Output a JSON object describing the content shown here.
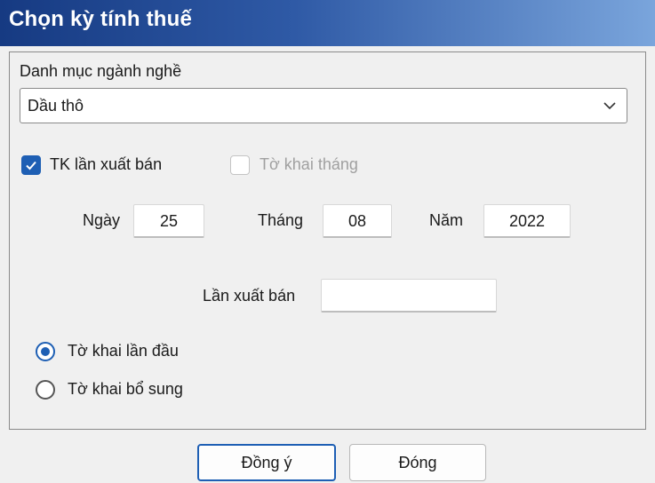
{
  "window": {
    "title": "Chọn kỳ tính thuế"
  },
  "category": {
    "label": "Danh mục ngành nghề",
    "selected": "Dầu thô"
  },
  "options": {
    "tk_lan_xuat_ban": {
      "label": "TK lần xuất bán",
      "checked": true
    },
    "to_khai_thang": {
      "label": "Tờ khai tháng",
      "checked": false,
      "disabled": true
    }
  },
  "date": {
    "day_label": "Ngày",
    "day_value": "25",
    "month_label": "Tháng",
    "month_value": "08",
    "year_label": "Năm",
    "year_value": "2022"
  },
  "sale_count": {
    "label": "Lần xuất bán",
    "value": ""
  },
  "declaration_type": {
    "first_label": "Tờ khai lần đầu",
    "supplement_label": "Tờ khai bổ sung",
    "selected": "first"
  },
  "buttons": {
    "ok": "Đồng ý",
    "close": "Đóng"
  },
  "colors": {
    "title_bar_start": "#163a82",
    "title_bar_end": "#7aa5dc",
    "accent": "#1e5fb4"
  }
}
